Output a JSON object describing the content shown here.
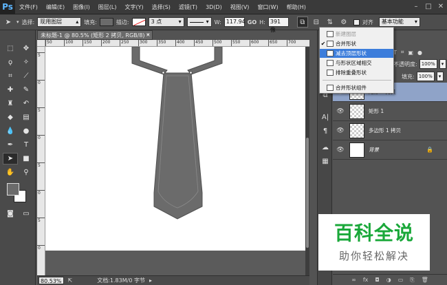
{
  "app": {
    "logo": "Ps"
  },
  "menu": [
    "文件(F)",
    "编辑(E)",
    "图像(I)",
    "图层(L)",
    "文字(Y)",
    "选择(S)",
    "滤镜(T)",
    "3D(D)",
    "视图(V)",
    "窗口(W)",
    "帮助(H)"
  ],
  "window_controls": [
    "–",
    "□",
    "✕"
  ],
  "options": {
    "select_label": "选择:",
    "select_value": "现用图层",
    "fill_label": "填充:",
    "stroke_label": "描边:",
    "stroke_size": "3 点",
    "w_label": "W:",
    "w_value": "117.94",
    "link": "GO",
    "h_label": "H:",
    "h_value": "391 像",
    "align_label": "对齐",
    "workspace": "基本功能"
  },
  "document": {
    "tab_title": "未标题-1 @ 80.5% (矩形 2 拷贝, RGB/8) *",
    "close": "×",
    "ruler_ticks": [
      "50",
      "100",
      "150",
      "200",
      "250",
      "300",
      "350",
      "400",
      "450",
      "500",
      "550",
      "600",
      "650",
      "700"
    ],
    "ruler_ticks_v": [
      "5",
      "0",
      "5",
      "0",
      "5",
      "0",
      "5",
      "0"
    ]
  },
  "status": {
    "zoom": "80.53%",
    "doc_info": "文档:1.83M/0 字节"
  },
  "dropdown": {
    "items": [
      {
        "label": "新建图层",
        "state": "disabled"
      },
      {
        "label": "合并形状",
        "state": "checked"
      },
      {
        "label": "减去顶层形状",
        "state": "highlighted"
      },
      {
        "label": "与形状区域相交",
        "state": "normal"
      },
      {
        "label": "排除重叠形状",
        "state": "normal"
      },
      {
        "label": "合并形状组件",
        "state": "normal"
      }
    ]
  },
  "layers_panel": {
    "opacity_label": "不透明度:",
    "opacity_value": "100%",
    "fill_label": "填充:",
    "fill_value": "100%",
    "partial_tab": "T",
    "layers": [
      {
        "name": "矩形 2 拷贝",
        "selected": true
      },
      {
        "name": "矩形 1",
        "selected": false
      },
      {
        "name": "多边形 1 拷贝",
        "selected": false
      },
      {
        "name": "背景",
        "selected": false,
        "locked": true
      }
    ]
  },
  "watermark": {
    "title": "百科全说",
    "subtitle": "助你轻松解决"
  },
  "colors": {
    "tie": "#6b6b6b",
    "tie_edge": "#4f4f4f",
    "highlight": "#3c7ddb",
    "watermark_green": "#1aa83a"
  }
}
